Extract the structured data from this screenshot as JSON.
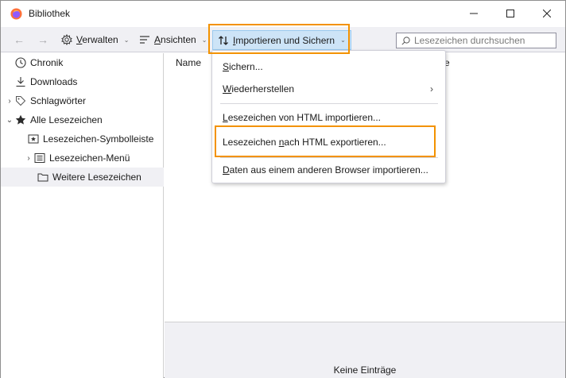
{
  "window": {
    "title": "Bibliothek",
    "controls": {
      "minimize": "—",
      "maximize": "☐",
      "close": "✕"
    }
  },
  "toolbar": {
    "back": "←",
    "forward": "→",
    "verwalten": {
      "u": "V",
      "rest": "erwalten"
    },
    "ansichten": {
      "u": "A",
      "rest": "nsichten"
    },
    "import": {
      "u": "I",
      "rest": "mportieren und Sichern"
    },
    "caret": "⌄",
    "search_placeholder": "Lesezeichen durchsuchen"
  },
  "sidebar": {
    "items": [
      {
        "label": "Chronik",
        "icon": "clock-icon",
        "twisty": ""
      },
      {
        "label": "Downloads",
        "icon": "download-icon",
        "twisty": ""
      },
      {
        "label": "Schlagwörter",
        "icon": "tag-icon",
        "twisty": "›"
      },
      {
        "label": "Alle Lesezeichen",
        "icon": "star-icon",
        "twisty": "⌄"
      },
      {
        "label": "Lesezeichen-Symbolleiste",
        "icon": "bookmark-toolbar-icon",
        "twisty": ""
      },
      {
        "label": "Lesezeichen-Menü",
        "icon": "bookmark-menu-icon",
        "twisty": "›"
      },
      {
        "label": "Weitere Lesezeichen",
        "icon": "folder-icon",
        "twisty": "",
        "selected": true
      }
    ]
  },
  "content": {
    "column_name": "Name",
    "column_partial": "e",
    "empty": "Keine Einträge"
  },
  "menu": {
    "items": [
      {
        "u": "S",
        "rest": "ichern..."
      },
      {
        "u": "W",
        "rest": "iederherstellen",
        "submenu": "›"
      },
      {
        "pre": "",
        "u": "L",
        "rest": "esezeichen von HTML importieren..."
      },
      {
        "pre": "Lesezeichen ",
        "u": "n",
        "rest": "ach HTML exportieren..."
      },
      {
        "u": "D",
        "rest": "aten aus einem anderen Browser importieren..."
      }
    ]
  }
}
